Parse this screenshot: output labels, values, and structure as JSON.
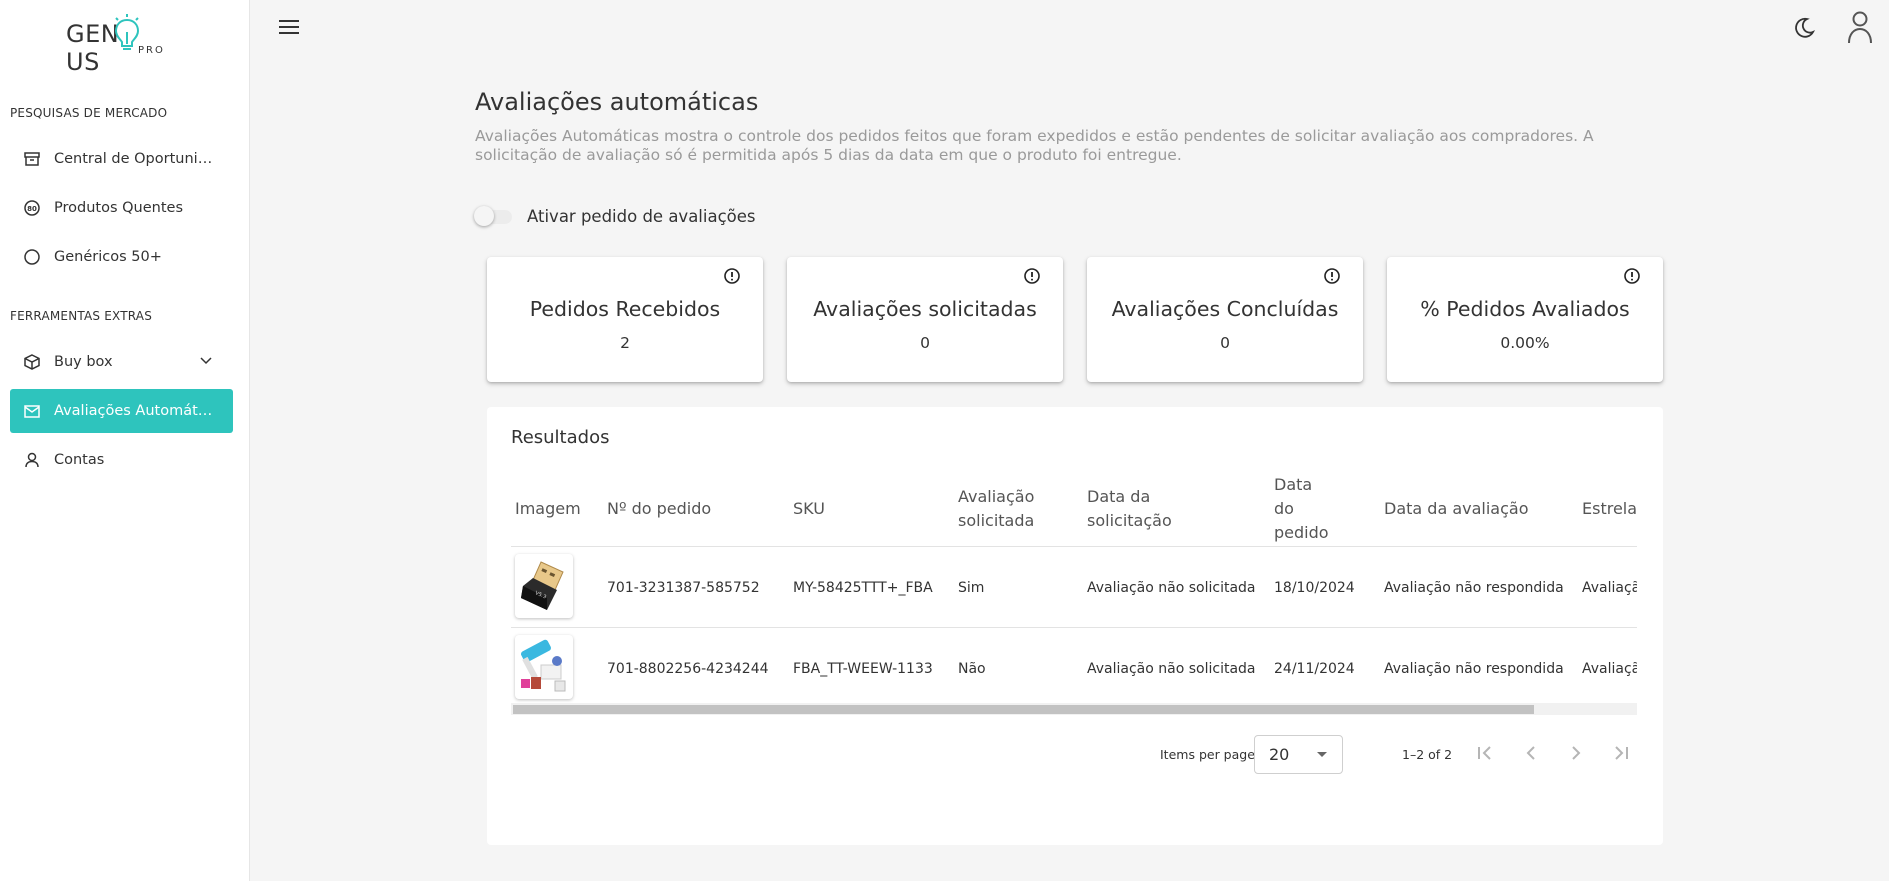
{
  "brand": {
    "name_left": "GEN",
    "name_right": "US",
    "sub": "PRO"
  },
  "sidebar": {
    "sections": [
      {
        "title": "PESQUISAS DE MERCADO"
      },
      {
        "title": "FERRAMENTAS EXTRAS"
      }
    ],
    "items": [
      {
        "label": "Central de Oportunidades",
        "icon": "archive-icon"
      },
      {
        "label": "Produtos Quentes",
        "icon": "hot-badge-icon"
      },
      {
        "label": "Genéricos 50+",
        "icon": "circle-icon"
      },
      {
        "label": "Buy box",
        "icon": "box-icon"
      },
      {
        "label": "Avaliações Automáticas",
        "icon": "mail-icon",
        "active": true
      },
      {
        "label": "Contas",
        "icon": "user-icon"
      }
    ]
  },
  "header": {
    "theme_icon": "moon-icon",
    "user_icon": "user-icon",
    "menu_icon": "hamburger-icon"
  },
  "page": {
    "title": "Avaliações automáticas",
    "description": "Avaliações Automáticas mostra o controle dos pedidos feitos que foram expedidos e estão pendentes de solicitar avaliação aos compradores. A solicitação de avaliação só é permitida após 5 dias da data em que o produto foi entregue.",
    "toggle_label": "Ativar pedido de avaliações",
    "toggle_on": false
  },
  "cards": [
    {
      "title": "Pedidos Recebidos",
      "value": "2"
    },
    {
      "title": "Avaliações solicitadas",
      "value": "0"
    },
    {
      "title": "Avaliações Concluídas",
      "value": "0"
    },
    {
      "title": "% Pedidos Avaliados",
      "value": "0.00%"
    }
  ],
  "results": {
    "title": "Resultados",
    "columns": {
      "image": "Imagem",
      "order_no": "Nº do pedido",
      "sku": "SKU",
      "review_requested": "Avaliação solicitada",
      "request_date": "Data da solicitação",
      "order_date": "Data do pedido",
      "review_date": "Data da avaliação",
      "stars": "Estrelas"
    },
    "rows": [
      {
        "order_no": "701-3231387-585752",
        "sku": "MY-58425TTT+_FBA",
        "review_requested": "Sim",
        "request_date": "Avaliação não solicitada",
        "order_date": "18/10/2024",
        "review_date": "Avaliação não respondida",
        "stars": "Avaliação"
      },
      {
        "order_no": "701-8802256-4234244",
        "sku": "FBA_TT-WEEW-1133",
        "review_requested": "Não",
        "request_date": "Avaliação não solicitada",
        "order_date": "24/11/2024",
        "review_date": "Avaliação não respondida",
        "stars": "Avaliação"
      }
    ],
    "pagination": {
      "items_per_page_label": "Items per page:",
      "items_per_page": "20",
      "range": "1–2 of 2"
    }
  }
}
